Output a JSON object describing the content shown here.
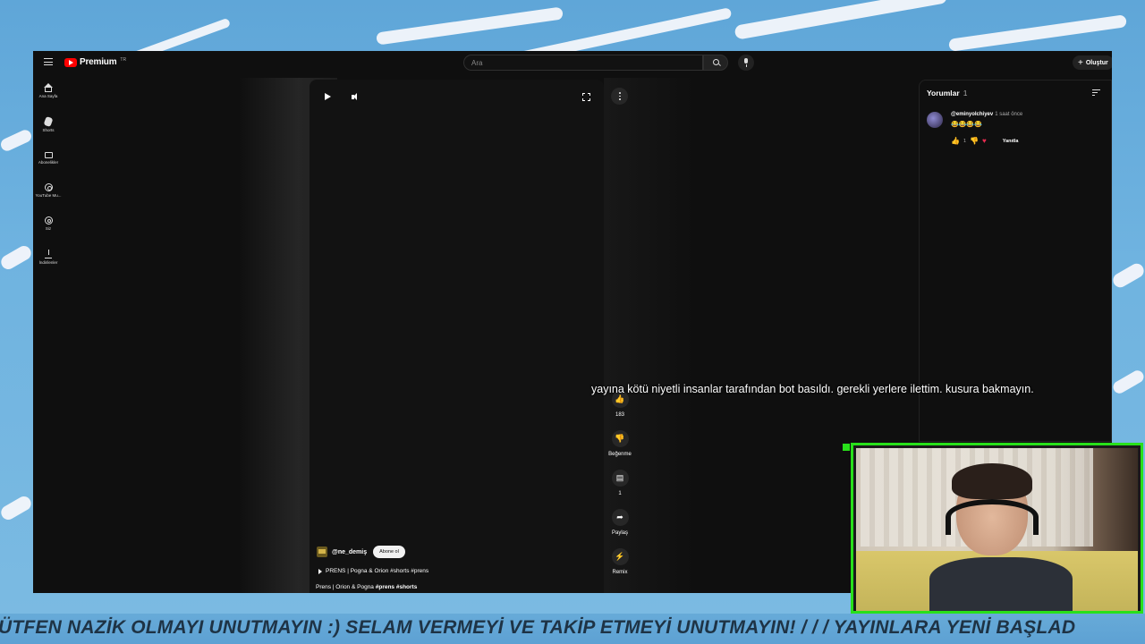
{
  "app": {
    "logo_text": "Premium",
    "logo_region": "TR",
    "search_placeholder": "Ara",
    "create_label": "Oluştur"
  },
  "sidebar": {
    "items": [
      {
        "label": "Ana Sayfa",
        "icon": "home-icon"
      },
      {
        "label": "Shorts",
        "icon": "shorts-icon"
      },
      {
        "label": "Abonelikler",
        "icon": "subscriptions-icon"
      },
      {
        "label": "YouTube Mu...",
        "icon": "music-icon"
      },
      {
        "label": "Siz",
        "icon": "you-icon"
      },
      {
        "label": "İndirilenler",
        "icon": "download-icon"
      }
    ]
  },
  "short": {
    "channel_name": "@ne_demiş",
    "subscribe_label": "Abone ol",
    "playlist": "PRENS | Pogna & Orion #shorts #prens",
    "title_plain": "Prens | Orion & Pogna ",
    "title_tags": "#prens #shorts"
  },
  "actions": {
    "like_count": "183",
    "dislike_label": "Beğenme",
    "comment_count": "1",
    "share_label": "Paylaş",
    "remix_label": "Remix"
  },
  "comments": {
    "header": "Yorumlar",
    "count": "1",
    "items": [
      {
        "author": "@eminyolchiyev",
        "time": "1 saat önce",
        "text": "😂😂😂😂",
        "likes": "1",
        "reply_label": "Yanıtla"
      }
    ]
  },
  "overlay_message": "yayına kötü niyetli insanlar tarafından bot basıldı. gerekli yerlere ilettim. kusura bakmayın.",
  "ticker": "ÜTFEN NAZİK OLMAYI UNUTMAYIN   :)   SELAM VERMEYİ VE TAKİP ETMEYİ UNUTMAYIN!   / / /  YAYINLARA YENİ BAŞLAD",
  "colors": {
    "youtube_red": "#ff0000",
    "webcam_border": "#28e01a",
    "background": "#0f0f0f"
  }
}
